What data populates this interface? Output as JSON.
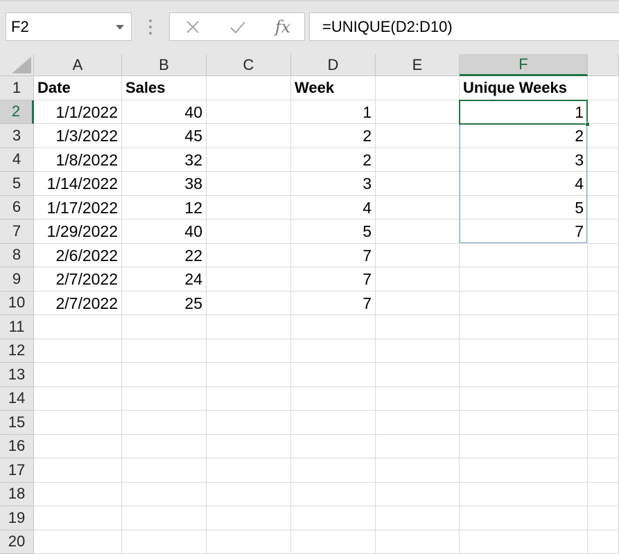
{
  "formula_bar": {
    "name_box": "F2",
    "cancel_icon": "x-icon",
    "enter_icon": "check-icon",
    "function_label": "fx",
    "formula": "=UNIQUE(D2:D10)"
  },
  "grid": {
    "columns": [
      "A",
      "B",
      "C",
      "D",
      "E",
      "F"
    ],
    "selected_column": "F",
    "row_numbers": [
      "1",
      "2",
      "3",
      "4",
      "5",
      "6",
      "7",
      "8",
      "9",
      "10",
      "11",
      "12",
      "13",
      "14",
      "15",
      "16",
      "17",
      "18",
      "19",
      "20"
    ],
    "selected_row": "2",
    "rows": [
      {
        "A": "Date",
        "B": "Sales",
        "C": "",
        "D": "Week",
        "E": "",
        "F": "Unique Weeks"
      },
      {
        "A": "1/1/2022",
        "B": "40",
        "C": "",
        "D": "1",
        "E": "",
        "F": "1"
      },
      {
        "A": "1/3/2022",
        "B": "45",
        "C": "",
        "D": "2",
        "E": "",
        "F": "2"
      },
      {
        "A": "1/8/2022",
        "B": "32",
        "C": "",
        "D": "2",
        "E": "",
        "F": "3"
      },
      {
        "A": "1/14/2022",
        "B": "38",
        "C": "",
        "D": "3",
        "E": "",
        "F": "4"
      },
      {
        "A": "1/17/2022",
        "B": "12",
        "C": "",
        "D": "4",
        "E": "",
        "F": "5"
      },
      {
        "A": "1/29/2022",
        "B": "40",
        "C": "",
        "D": "5",
        "E": "",
        "F": "7"
      },
      {
        "A": "2/6/2022",
        "B": "22",
        "C": "",
        "D": "7",
        "E": "",
        "F": ""
      },
      {
        "A": "2/7/2022",
        "B": "24",
        "C": "",
        "D": "7",
        "E": "",
        "F": ""
      },
      {
        "A": "2/7/2022",
        "B": "25",
        "C": "",
        "D": "7",
        "E": "",
        "F": ""
      }
    ]
  },
  "colors": {
    "selection_accent": "#217346",
    "spill_border": "#7ba0d4"
  }
}
